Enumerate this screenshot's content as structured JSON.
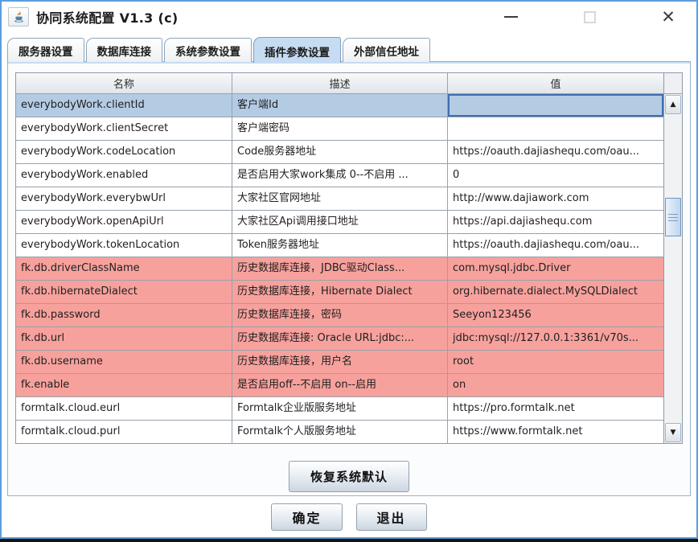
{
  "window": {
    "title": "协同系统配置 V1.3 (c)",
    "icon": "java-coffee-cup",
    "controls": {
      "minimize": "minimize",
      "maximize": "maximize (disabled)",
      "close": "×"
    }
  },
  "tabs": [
    {
      "label": "服务器设置",
      "active": false
    },
    {
      "label": "数据库连接",
      "active": false
    },
    {
      "label": "系统参数设置",
      "active": false
    },
    {
      "label": "插件参数设置",
      "active": true
    },
    {
      "label": "外部信任地址",
      "active": false
    }
  ],
  "table": {
    "columns": [
      "名称",
      "描述",
      "值"
    ],
    "rows": [
      {
        "name": "everybodyWork.clientId",
        "desc": "客户端Id",
        "value": "",
        "state": "selected"
      },
      {
        "name": "everybodyWork.clientSecret",
        "desc": "客户端密码",
        "value": "",
        "state": "normal"
      },
      {
        "name": "everybodyWork.codeLocation",
        "desc": "Code服务器地址",
        "value": "https://oauth.dajiashequ.com/oau...",
        "state": "normal"
      },
      {
        "name": "everybodyWork.enabled",
        "desc": "是否启用大家work集成 0--不启用  ...",
        "value": "0",
        "state": "normal"
      },
      {
        "name": "everybodyWork.everybwUrl",
        "desc": "大家社区官网地址",
        "value": "http://www.dajiawork.com",
        "state": "normal"
      },
      {
        "name": "everybodyWork.openApiUrl",
        "desc": "大家社区Api调用接口地址",
        "value": "https://api.dajiashequ.com",
        "state": "normal"
      },
      {
        "name": "everybodyWork.tokenLocation",
        "desc": "Token服务器地址",
        "value": "https://oauth.dajiashequ.com/oau...",
        "state": "normal"
      },
      {
        "name": "fk.db.driverClassName",
        "desc": "历史数据库连接，JDBC驱动Class...",
        "value": "com.mysql.jdbc.Driver",
        "state": "highlight"
      },
      {
        "name": "fk.db.hibernateDialect",
        "desc": "历史数据库连接，Hibernate Dialect",
        "value": "org.hibernate.dialect.MySQLDialect",
        "state": "highlight"
      },
      {
        "name": "fk.db.password",
        "desc": "历史数据库连接，密码",
        "value": "Seeyon123456",
        "state": "highlight"
      },
      {
        "name": "fk.db.url",
        "desc": "历史数据库连接: Oracle URL:jdbc:...",
        "value": "jdbc:mysql://127.0.0.1:3361/v70s...",
        "state": "highlight"
      },
      {
        "name": "fk.db.username",
        "desc": "历史数据库连接，用户名",
        "value": "root",
        "state": "highlight"
      },
      {
        "name": "fk.enable",
        "desc": "是否启用off--不启用  on--启用",
        "value": "on",
        "state": "highlight"
      },
      {
        "name": "formtalk.cloud.eurl",
        "desc": "Formtalk企业版服务地址",
        "value": "https://pro.formtalk.net",
        "state": "normal"
      },
      {
        "name": "formtalk.cloud.purl",
        "desc": "Formtalk个人版服务地址",
        "value": "https://www.formtalk.net",
        "state": "normal"
      }
    ]
  },
  "scrollbar": {
    "up_glyph": "▲",
    "down_glyph": "▼"
  },
  "buttons": {
    "restore_defaults": "恢复系统默认",
    "ok": "确定",
    "exit": "退出"
  },
  "colors": {
    "selected_row": "#b4cbe4",
    "selected_cell_border": "#3f6fae",
    "highlight_row": "#f7a19d",
    "tab_active": "#c6dcf3",
    "window_border": "#5b9ddd"
  }
}
